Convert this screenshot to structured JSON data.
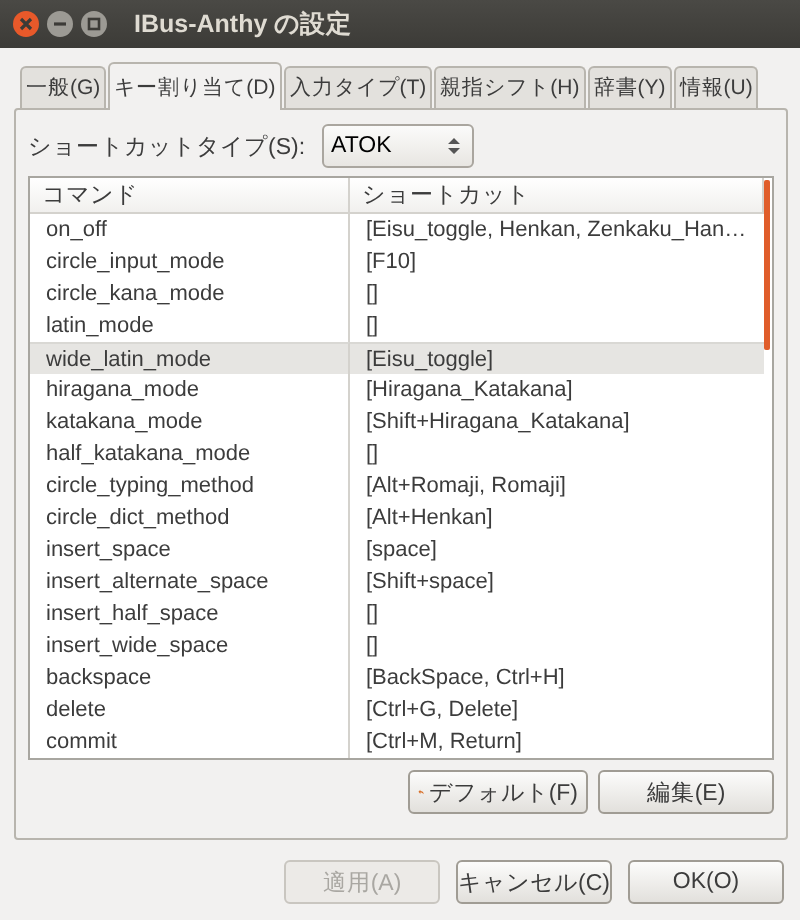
{
  "window": {
    "title": "IBus-Anthy の設定"
  },
  "tabs": [
    {
      "label": "一般(G)",
      "selected": false
    },
    {
      "label": "キー割り当て(D)",
      "selected": true
    },
    {
      "label": "入力タイプ(T)",
      "selected": false
    },
    {
      "label": "親指シフト(H)",
      "selected": false
    },
    {
      "label": "辞書(Y)",
      "selected": false
    },
    {
      "label": "情報(U)",
      "selected": false
    }
  ],
  "shortcut_type": {
    "label": "ショートカットタイプ(S):",
    "value": "ATOK"
  },
  "table": {
    "columns": [
      "コマンド",
      "ショートカット"
    ],
    "rows": [
      {
        "cells": [
          "on_off",
          "[Eisu_toggle, Henkan, Zenkaku_Han…"
        ],
        "selected": false
      },
      {
        "cells": [
          "circle_input_mode",
          "[F10]"
        ],
        "selected": false
      },
      {
        "cells": [
          "circle_kana_mode",
          "[]"
        ],
        "selected": false
      },
      {
        "cells": [
          "latin_mode",
          "[]"
        ],
        "selected": false
      },
      {
        "cells": [
          "wide_latin_mode",
          "[Eisu_toggle]"
        ],
        "selected": true
      },
      {
        "cells": [
          "hiragana_mode",
          "[Hiragana_Katakana]"
        ],
        "selected": false
      },
      {
        "cells": [
          "katakana_mode",
          "[Shift+Hiragana_Katakana]"
        ],
        "selected": false
      },
      {
        "cells": [
          "half_katakana_mode",
          "[]"
        ],
        "selected": false
      },
      {
        "cells": [
          "circle_typing_method",
          "[Alt+Romaji, Romaji]"
        ],
        "selected": false
      },
      {
        "cells": [
          "circle_dict_method",
          "[Alt+Henkan]"
        ],
        "selected": false
      },
      {
        "cells": [
          "insert_space",
          "[space]"
        ],
        "selected": false
      },
      {
        "cells": [
          "insert_alternate_space",
          "[Shift+space]"
        ],
        "selected": false
      },
      {
        "cells": [
          "insert_half_space",
          "[]"
        ],
        "selected": false
      },
      {
        "cells": [
          "insert_wide_space",
          "[]"
        ],
        "selected": false
      },
      {
        "cells": [
          "backspace",
          "[BackSpace, Ctrl+H]"
        ],
        "selected": false
      },
      {
        "cells": [
          "delete",
          "[Ctrl+G, Delete]"
        ],
        "selected": false
      },
      {
        "cells": [
          "commit",
          "[Ctrl+M, Return]"
        ],
        "selected": false
      }
    ]
  },
  "table_buttons": [
    {
      "label": "デフォルト(F)",
      "kind": "revert"
    },
    {
      "label": "編集(E)",
      "kind": "plain"
    }
  ],
  "dialog_buttons": [
    {
      "label": "適用(A)",
      "disabled": true
    },
    {
      "label": "キャンセル(C)",
      "disabled": false
    },
    {
      "label": "OK(O)",
      "disabled": false
    }
  ]
}
